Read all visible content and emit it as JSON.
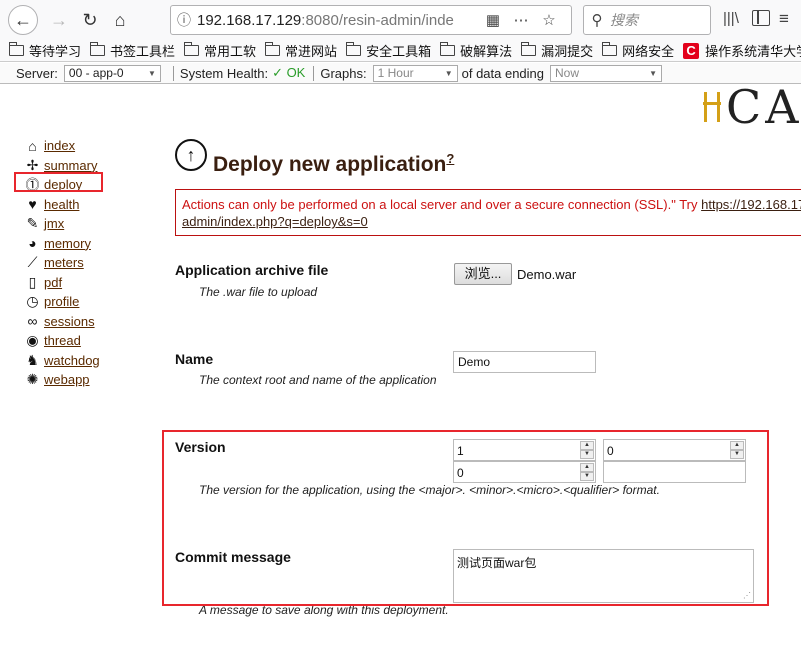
{
  "browser": {
    "url_host": "192.168.17.129",
    "url_rest": ":8080/resin-admin/inde",
    "search_placeholder": "搜索",
    "icons": [
      "back-icon",
      "forward-icon",
      "reload-icon",
      "home-icon",
      "info-icon",
      "qr-icon",
      "more-icon",
      "star-icon",
      "search-icon",
      "library-icon",
      "sidebar-icon",
      "menu-icon"
    ]
  },
  "bookmarks": [
    {
      "label": "等待学习"
    },
    {
      "label": "书签工具栏"
    },
    {
      "label": "常用工软"
    },
    {
      "label": "常进网站"
    },
    {
      "label": "安全工具箱"
    },
    {
      "label": "破解算法"
    },
    {
      "label": "漏洞提交"
    },
    {
      "label": "网络安全"
    },
    {
      "label": "操作系统清华大学",
      "logo": "C"
    }
  ],
  "statusbar": {
    "server_label": "Server:",
    "server_value": "00 - app-0",
    "health_label": "System Health:",
    "health_status": "✓ OK",
    "graphs_label": "Graphs:",
    "graphs_value": "1 Hour",
    "ending_label": "of data ending",
    "ending_value": "Now"
  },
  "logo": {
    "text": "CA"
  },
  "nav": [
    {
      "label": "index",
      "icon": "home-icon"
    },
    {
      "label": "summary",
      "icon": "summary-icon"
    },
    {
      "label": "deploy",
      "icon": "deploy-icon"
    },
    {
      "label": "health",
      "icon": "heart-icon"
    },
    {
      "label": "jmx",
      "icon": "wrench-icon"
    },
    {
      "label": "memory",
      "icon": "memory-icon"
    },
    {
      "label": "meters",
      "icon": "chart-icon"
    },
    {
      "label": "pdf",
      "icon": "document-icon"
    },
    {
      "label": "profile",
      "icon": "stopwatch-icon"
    },
    {
      "label": "sessions",
      "icon": "sessions-icon"
    },
    {
      "label": "thread",
      "icon": "thread-icon"
    },
    {
      "label": "watchdog",
      "icon": "dog-icon"
    },
    {
      "label": "webapp",
      "icon": "web-icon"
    }
  ],
  "main": {
    "title": "Deploy new application",
    "help": "?",
    "error_text": "Actions can only be performed on a local server and over a secure connection (SSL).\" Try ",
    "error_link_1": "https://192.168.17",
    "error_link_2": "admin/index.php?q=deploy&s=0",
    "archive": {
      "label": "Application archive file",
      "desc": "The .war file to upload",
      "button": "浏览...",
      "file": "Demo.war"
    },
    "name": {
      "label": "Name",
      "desc": "The context root and name of the application",
      "value": "Demo"
    },
    "version": {
      "label": "Version",
      "desc": "The version for the application, using the <major>. <minor>.<micro>.<qualifier> format.",
      "major": "1",
      "minor": "0",
      "micro": "0",
      "qualifier": ""
    },
    "commit": {
      "label": "Commit message",
      "desc": "A message to save along with this deployment.",
      "value": "测试页面war包"
    }
  }
}
